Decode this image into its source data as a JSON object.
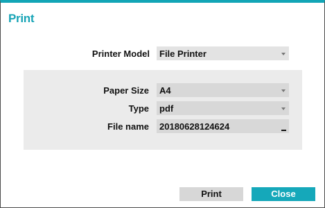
{
  "dialog": {
    "title": "Print"
  },
  "printer_model": {
    "label": "Printer Model",
    "value": "File Printer",
    "icon": "chevron-down-icon"
  },
  "paper_size": {
    "label": "Paper Size",
    "value": "A4",
    "icon": "chevron-down-icon"
  },
  "type": {
    "label": "Type",
    "value": "pdf",
    "icon": "chevron-down-icon"
  },
  "file_name": {
    "label": "File name",
    "value": "20180628124624"
  },
  "buttons": {
    "print_label": "Print",
    "close_label": "Close"
  },
  "colors": {
    "accent": "#15a8ba",
    "field_bg": "#e3e3e3",
    "panel_bg": "#ebebeb",
    "button_bg": "#d7d7d7"
  }
}
